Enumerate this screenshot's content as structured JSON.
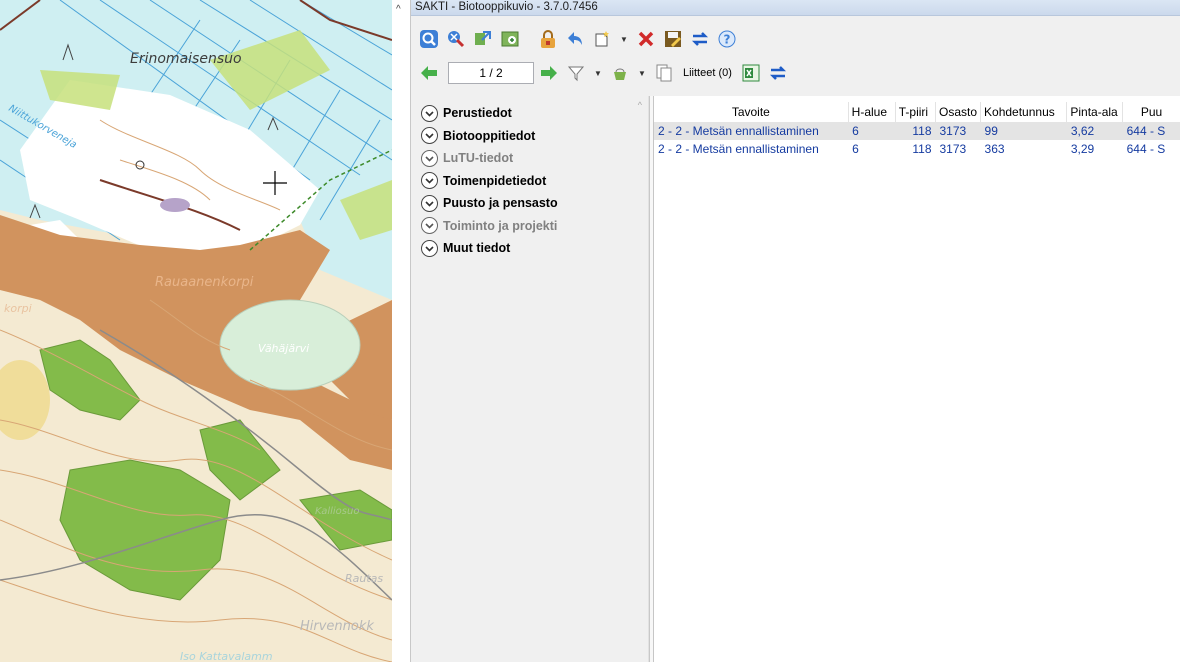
{
  "map": {
    "labels": {
      "erinomaisensuo": "Erinomaisensuo",
      "niittykorveneja": "Niittukorveneja",
      "rauanmenkorpi": "Rauaanenkorpi",
      "vahajarvi": "Vähäjärvi",
      "korpi": "korpi",
      "hirvennokk": "Hirvennokk",
      "rautas": "Rautas",
      "isokattava": "Iso Kattavalamm",
      "kalliosuo": "Kalliosuo"
    },
    "colors": {
      "base": "#f4ead2",
      "water": "#cfeff2",
      "bog": "#ffffff",
      "habitat_brown": "#d1935e",
      "habitat_green": "#83bb4a",
      "contour": "#d8a675",
      "road": "#7b3a2a"
    }
  },
  "splitter": {
    "arrow": "^"
  },
  "app": {
    "title": "SAKTI - Biotooppikuvio - 3.7.0.7456",
    "toolbar": {
      "icons": [
        "zoom-icon",
        "zoom-reset-icon",
        "map-link-icon",
        "map-add-icon",
        "lock-icon",
        "undo-icon",
        "new-icon",
        "delete-icon",
        "save-edit-icon",
        "sync-icon",
        "help-icon"
      ]
    },
    "pager": {
      "current": "1 / 2",
      "attachments_label": "Liitteet (0)"
    },
    "nav": {
      "items": [
        {
          "label": "Perustiedot",
          "enabled": true
        },
        {
          "label": "Biotooppitiedot",
          "enabled": true
        },
        {
          "label": "LuTU-tiedot",
          "enabled": false
        },
        {
          "label": "Toimenpidetiedot",
          "enabled": true
        },
        {
          "label": "Puusto ja pensasto",
          "enabled": true
        },
        {
          "label": "Toiminto ja projekti",
          "enabled": false
        },
        {
          "label": "Muut tiedot",
          "enabled": true
        }
      ]
    },
    "grid": {
      "columns": [
        "Tavoite",
        "H-alue",
        "T-piiri",
        "Osasto",
        "Kohdetunnus",
        "Pinta-ala",
        "Puu"
      ],
      "rows": [
        {
          "tavoite": "2 - 2 - Metsän ennallistaminen",
          "halue": "6",
          "tpiiri": "118",
          "osasto": "3173",
          "kohdetunnus": "99",
          "pinta_ala": "3,62",
          "puu": "644 - S"
        },
        {
          "tavoite": "2 - 2 - Metsän ennallistaminen",
          "halue": "6",
          "tpiiri": "118",
          "osasto": "3173",
          "kohdetunnus": "363",
          "pinta_ala": "3,29",
          "puu": "644 - S"
        }
      ]
    }
  }
}
